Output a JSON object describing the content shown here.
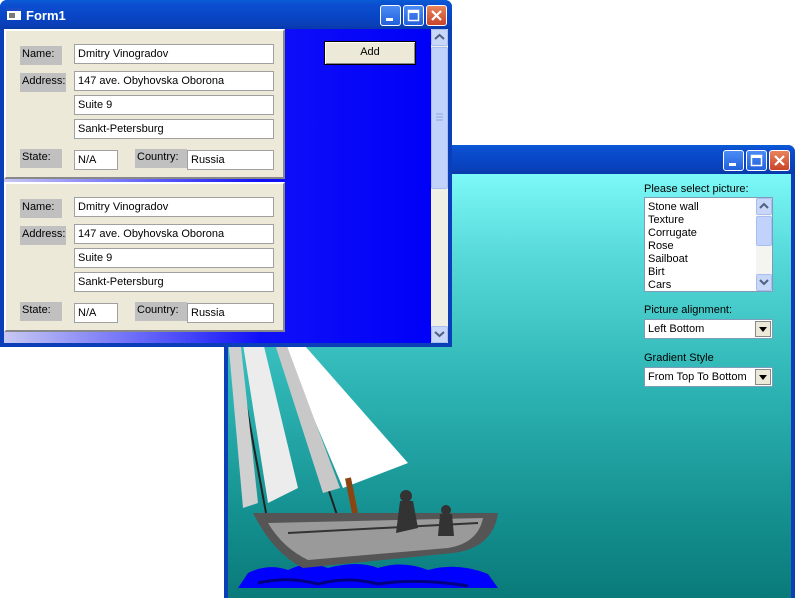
{
  "form2": {
    "title": "",
    "picture_label": "Please select picture:",
    "pictures": [
      "Stone wall",
      "Texture",
      "Corrugate",
      "Rose",
      "Sailboat",
      "Birt",
      "Cars"
    ],
    "alignment_label": "Picture alignment:",
    "alignment_value": "Left Bottom",
    "gradient_label": "Gradient Style",
    "gradient_value": "From Top To Bottom"
  },
  "form1": {
    "title": "Form1",
    "add_label": "Add",
    "records": [
      {
        "name_label": "Name:",
        "name": "Dmitry Vinogradov",
        "address_label": "Address:",
        "address1": "147 ave. Obyhovska Oborona",
        "address2": "Suite 9",
        "address3": "Sankt-Petersburg",
        "state_label": "State:",
        "state": "N/A",
        "country_label": "Country:",
        "country": "Russia"
      },
      {
        "name_label": "Name:",
        "name": "Dmitry Vinogradov",
        "address_label": "Address:",
        "address1": "147 ave. Obyhovska Oborona",
        "address2": "Suite 9",
        "address3": "Sankt-Petersburg",
        "state_label": "State:",
        "state": "N/A",
        "country_label": "Country:",
        "country": "Russia"
      }
    ]
  },
  "colors": {
    "titlebar": "#0a3fb8",
    "form_bg": "#ece9d8",
    "gradient_top": "#7cf8f8",
    "gradient_bottom": "#0a7a7a"
  }
}
